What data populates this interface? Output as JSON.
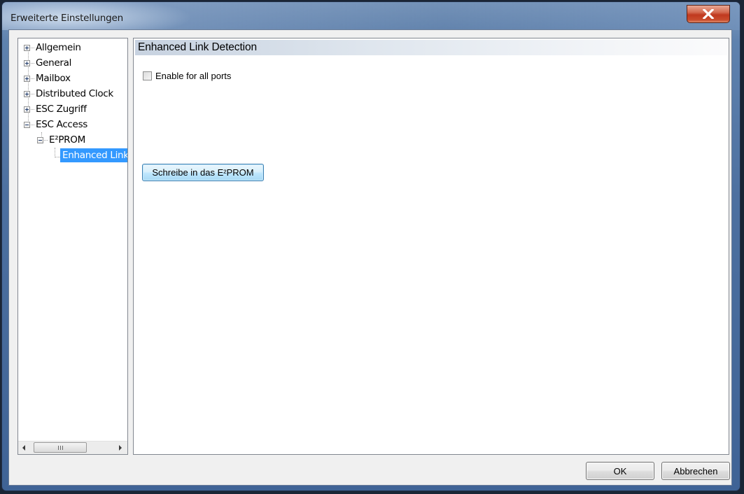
{
  "window": {
    "title": "Erweiterte Einstellungen",
    "close_icon": "close-icon"
  },
  "tree": {
    "items": [
      {
        "label": "Allgemein",
        "expander": "plus"
      },
      {
        "label": "General",
        "expander": "plus"
      },
      {
        "label": "Mailbox",
        "expander": "plus"
      },
      {
        "label": "Distributed Clock",
        "expander": "plus"
      },
      {
        "label": "ESC Zugriff",
        "expander": "plus"
      },
      {
        "label": "ESC Access",
        "expander": "minus"
      },
      {
        "label": "E²PROM",
        "expander": "minus"
      },
      {
        "label": "Enhanced Link",
        "expander": "none",
        "selected": true
      }
    ],
    "scrollbar_icon": "scroll-grip-icon"
  },
  "panel": {
    "title": "Enhanced Link Detection",
    "checkbox_label": "Enable for all ports",
    "checkbox_checked": false,
    "write_button_label": "Schreibe in das E²PROM"
  },
  "footer": {
    "ok_label": "OK",
    "cancel_label": "Abbrechen"
  }
}
